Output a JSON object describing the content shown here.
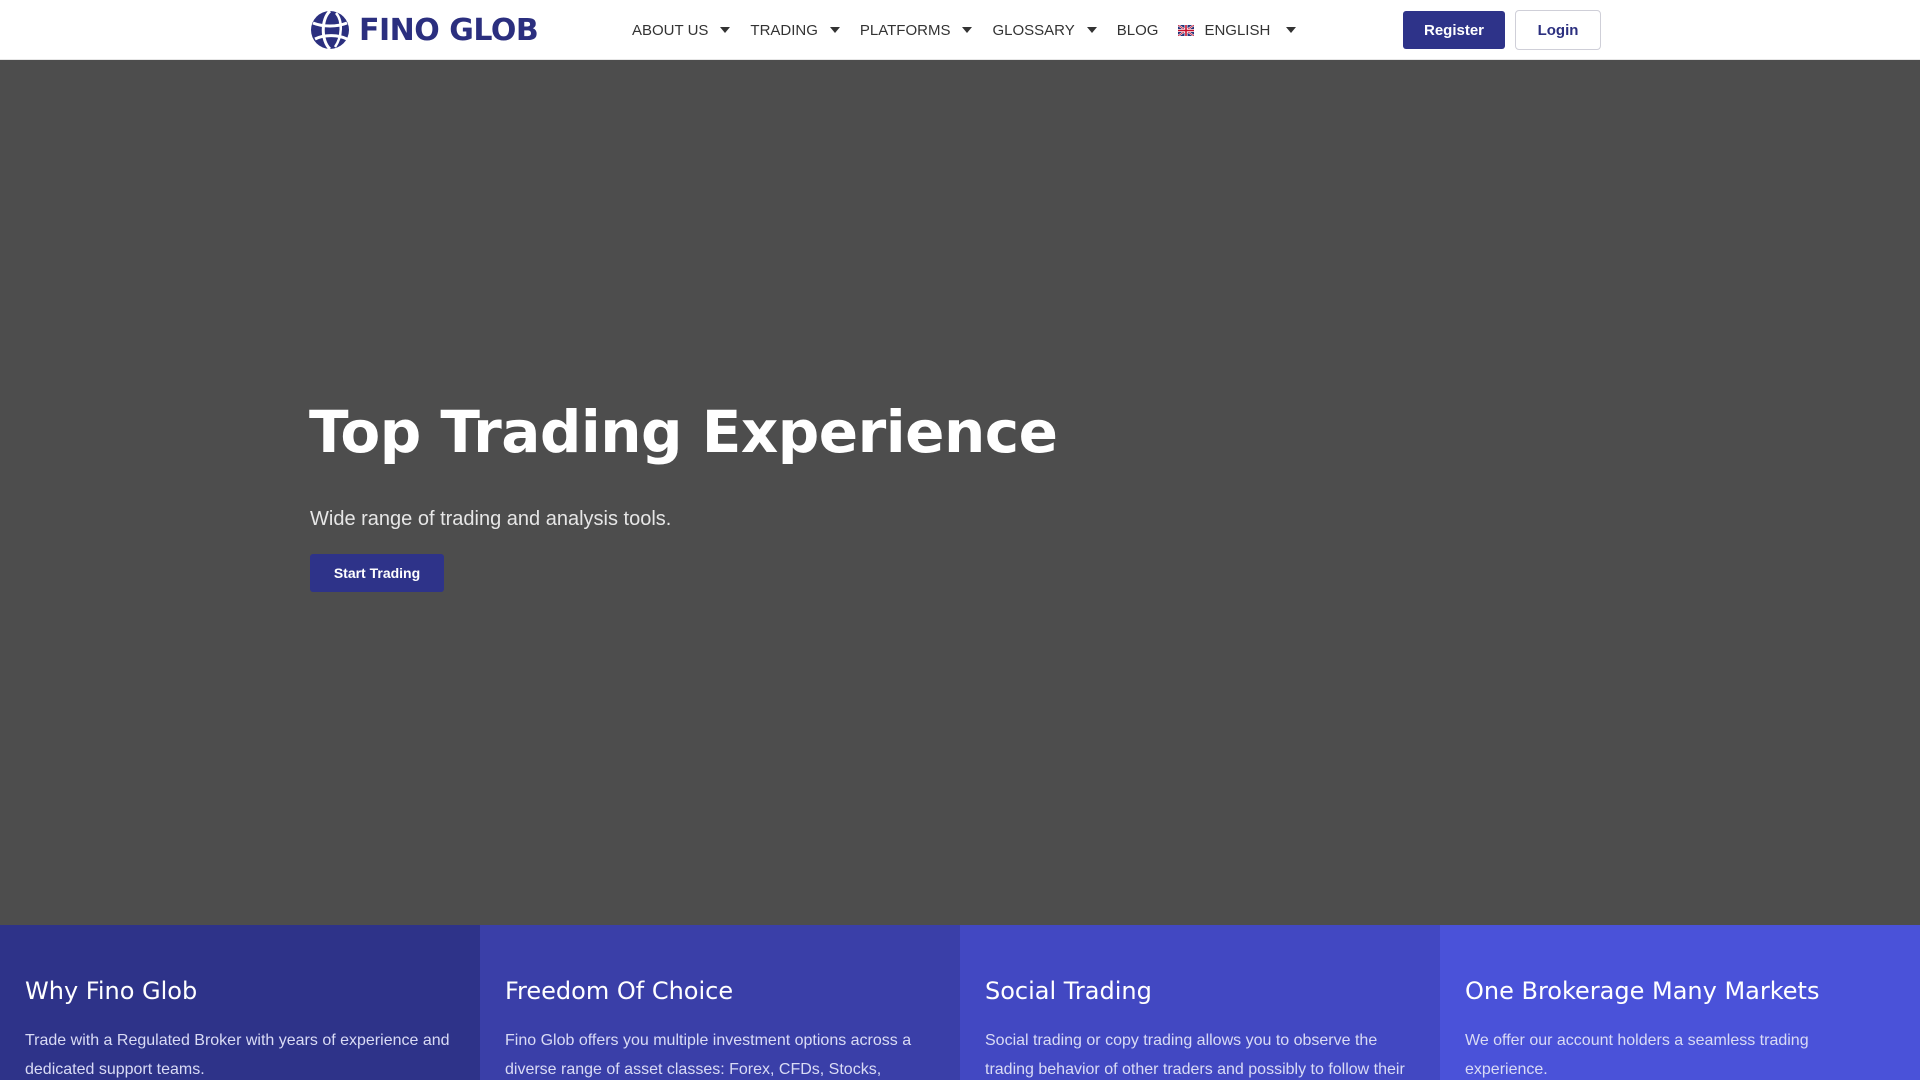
{
  "header": {
    "logo_text": "FINO GLOB",
    "nav": [
      {
        "label": "ABOUT US",
        "icon": "caret-down-icon"
      },
      {
        "label": "TRADING",
        "icon": "caret-down-icon"
      },
      {
        "label": "PLATFORMS",
        "icon": "caret-down-icon"
      },
      {
        "label": "GLOSSARY",
        "icon": "caret-down-icon"
      },
      {
        "label": "BLOG"
      },
      {
        "label": "ENGLISH",
        "icon": "caret-down-icon",
        "flag": "uk-flag-icon"
      }
    ],
    "register_label": "Register",
    "login_label": "Login"
  },
  "hero": {
    "title": "Top Trading Experience",
    "subtitle": "Wide range of trading and analysis tools.",
    "cta_label": "Start Trading"
  },
  "features": [
    {
      "title": "Why Fino Glob",
      "text": "Trade with a Regulated Broker with years of experience and dedicated support teams.",
      "color": "#2e3389"
    },
    {
      "title": "Freedom Of Choice",
      "text": "Fino Glob offers you multiple investment options across a diverse range of asset classes: Forex, CFDs, Stocks,",
      "color": "#3a3fa8"
    },
    {
      "title": "Social Trading",
      "text": "Social trading or copy trading allows you to observe the trading behavior of other traders and possibly to follow their",
      "color": "#4248c2"
    },
    {
      "title": "One Brokerage Many Markets",
      "text": "We offer our account holders a seamless trading experience.",
      "color": "#4a52d9"
    }
  ],
  "colors": {
    "brand": "#2e3389",
    "hero_bg": "#4d4d4d"
  }
}
